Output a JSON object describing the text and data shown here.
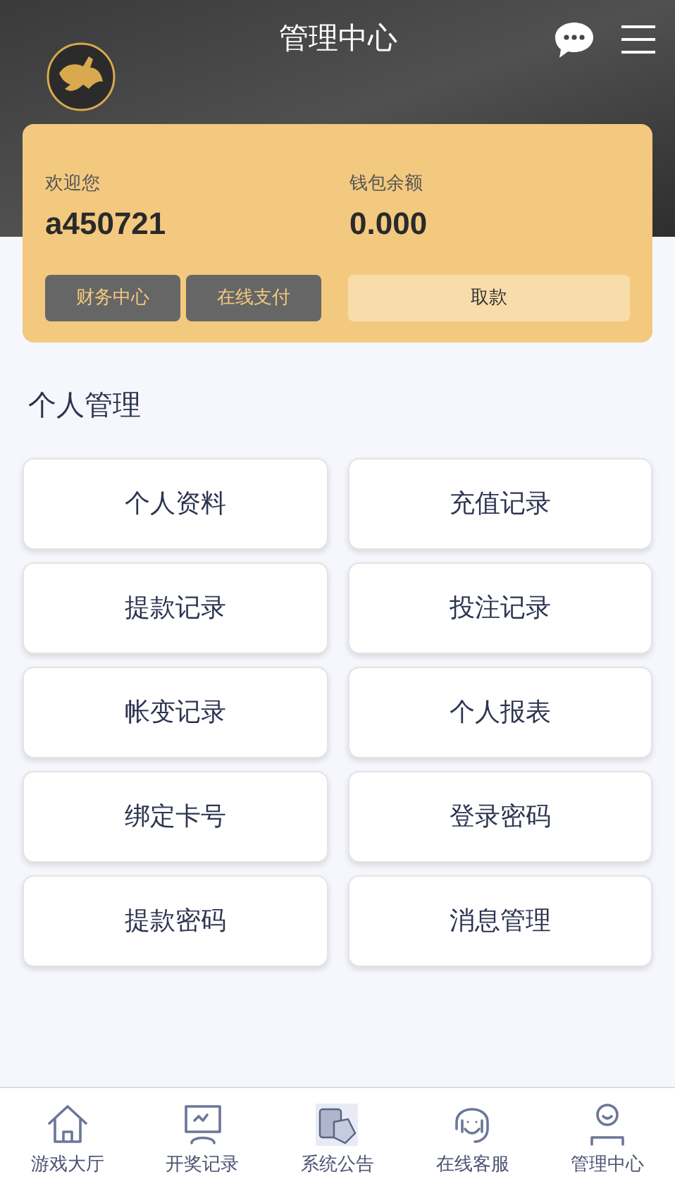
{
  "header": {
    "title": "管理中心"
  },
  "account": {
    "welcome_label": "欢迎您",
    "username": "a450721",
    "balance_label": "钱包余额",
    "balance": "0.000",
    "buttons": [
      "财务中心",
      "在线支付"
    ],
    "withdraw_button": "取款"
  },
  "section": {
    "title": "个人管理",
    "items": [
      "个人资料",
      "充值记录",
      "提款记录",
      "投注记录",
      "帐变记录",
      "个人报表",
      "绑定卡号",
      "登录密码",
      "提款密码",
      "消息管理"
    ]
  },
  "bottom_nav": [
    {
      "label": "游戏大厅",
      "kind": "home"
    },
    {
      "label": "开奖记录",
      "kind": "monitor"
    },
    {
      "label": "系统公告",
      "kind": "cards"
    },
    {
      "label": "在线客服",
      "kind": "headset"
    },
    {
      "label": "管理中心",
      "kind": "user"
    }
  ]
}
